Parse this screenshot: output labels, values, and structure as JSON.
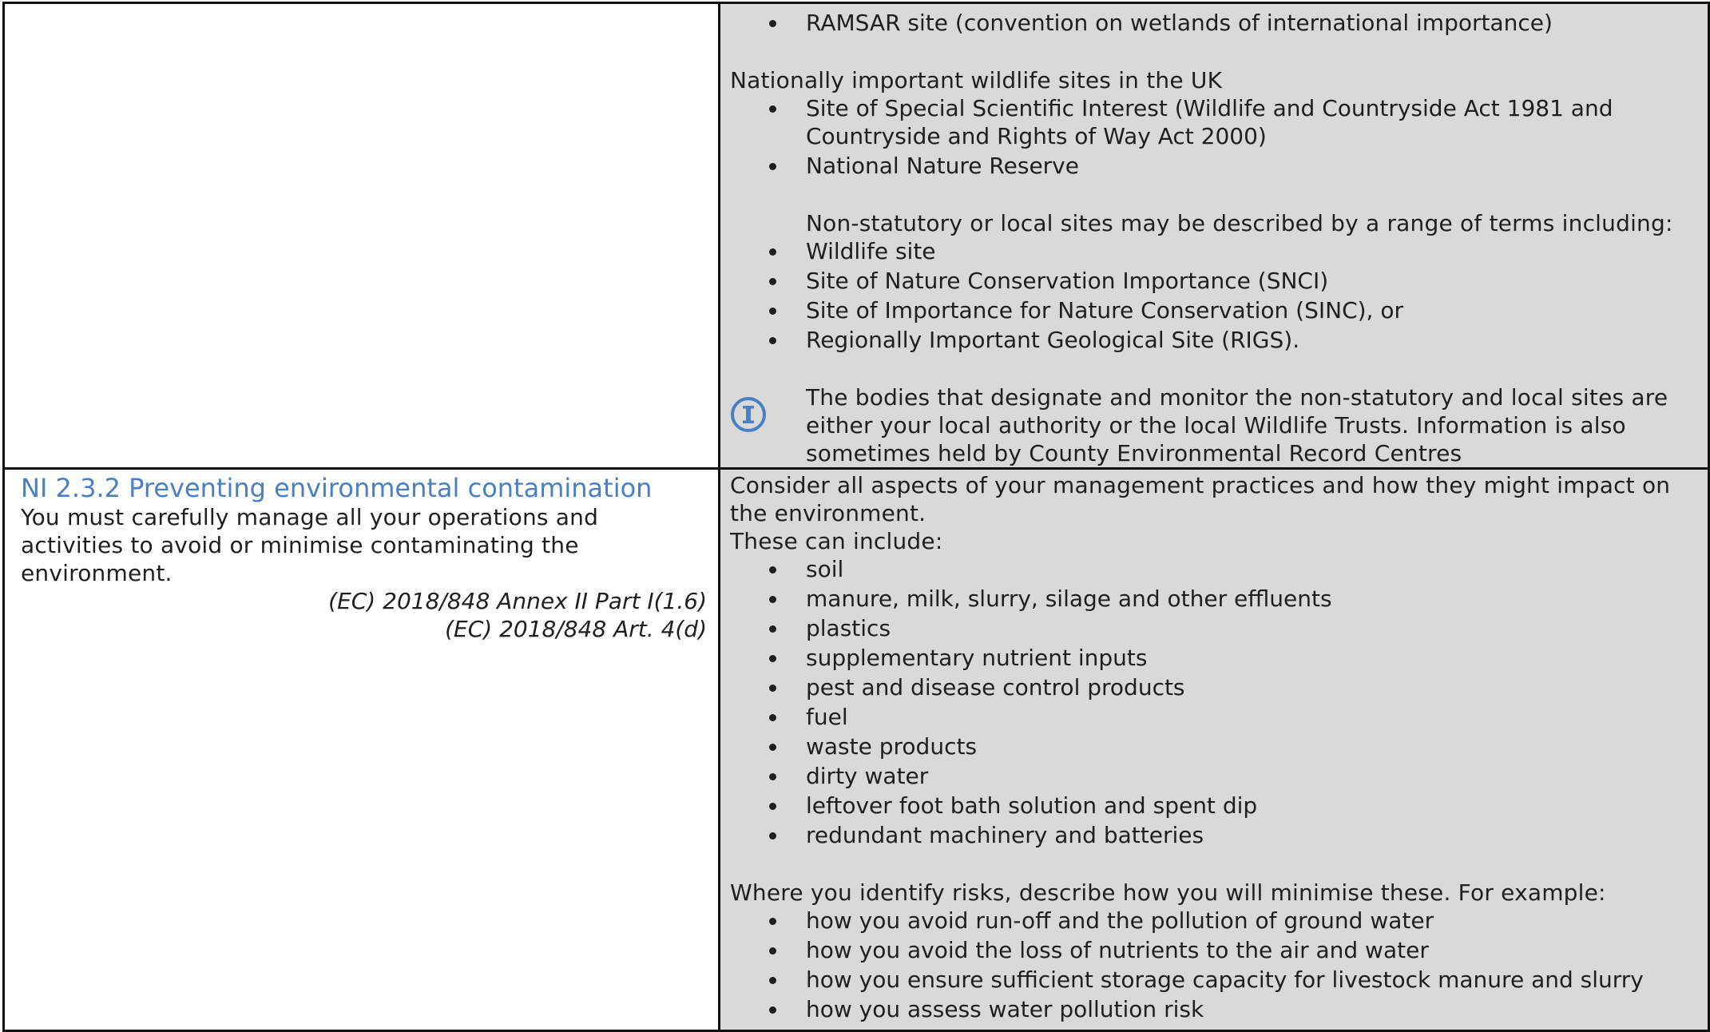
{
  "row1": {
    "right": {
      "top_bullets": [
        "RAMSAR site (convention on wetlands of international importance)"
      ],
      "national_heading": "Nationally important wildlife sites in the UK",
      "national_bullets": [
        "Site of Special Scientific Interest (Wildlife and Countryside Act 1981 and Countryside and Rights of Way Act 2000)",
        "National Nature Reserve"
      ],
      "nonstatutory_intro": "Non-statutory or local sites may be described by a range of terms including:",
      "nonstatutory_bullets": [
        "Wildlife site",
        "Site of Nature Conservation Importance (SNCI)",
        "Site of Importance for Nature Conservation (SINC), or",
        "Regionally Important Geological Site (RIGS)."
      ],
      "info_icon": "info-circle-icon",
      "info_text": "The bodies that designate and monitor the non-statutory and local sites are either your local authority or the local Wildlife Trusts. Information is also sometimes held by County Environmental Record Centres"
    }
  },
  "row2": {
    "left": {
      "heading": "NI 2.3.2 Preventing environmental contamination",
      "body": "You must carefully manage all your operations and activities to avoid or minimise contaminating the environment.",
      "refs": [
        "(EC) 2018/848 Annex II Part I(1.6)",
        "(EC) 2018/848 Art. 4(d)"
      ]
    },
    "right": {
      "intro": "Consider all aspects of your management practices and how they might impact on the environment.",
      "include_label": "These can include:",
      "include_bullets": [
        "soil",
        "manure, milk, slurry, silage and other effluents",
        "plastics",
        "supplementary nutrient inputs",
        "pest and disease control products",
        "fuel",
        "waste products",
        "dirty water",
        "leftover foot bath solution and spent dip",
        "redundant machinery and batteries"
      ],
      "risks_intro": "Where you identify risks, describe how you will minimise these. For example:",
      "risk_bullets": [
        "how you avoid run-off and the pollution of ground water",
        "how you avoid the loss of nutrients to the air and water",
        "how you ensure sufficient storage capacity for livestock manure and slurry",
        "how you assess water pollution risk"
      ]
    }
  },
  "colors": {
    "heading": "#4a7fc1",
    "right_cell_bg": "#d9d9d9",
    "border": "#111111",
    "icon": "#4a7fc1"
  }
}
